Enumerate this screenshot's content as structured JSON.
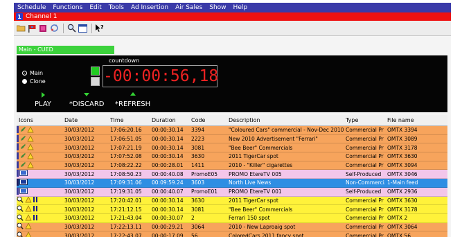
{
  "menu": [
    "Schedule",
    "Functions",
    "Edit",
    "Tools",
    "Ad Insertion",
    "Air Sales",
    "Show",
    "Help"
  ],
  "channel": {
    "number": "1",
    "title": "Channel 1"
  },
  "status": "Main - CUED",
  "countdown": {
    "label": "countdown",
    "value": "-00:00:56,18",
    "main_label": "Main",
    "clone_label": "Clone"
  },
  "controls": {
    "play": "PLAY",
    "discard": "*DISCARD",
    "refresh": "*REFRESH"
  },
  "columns": [
    "Icons",
    "Date",
    "Time",
    "Duration",
    "Code",
    "Description",
    "Type",
    "File name"
  ],
  "colors": {
    "orange": "#f7a45c",
    "pink": "#f3c6ea",
    "blue": "#2e8ee3",
    "yellow": "#fff23a",
    "accent_red": "#ee1111",
    "menubar": "#3a3aa8"
  },
  "rows": [
    {
      "color": "#f7a45c",
      "icons": "edit-warn",
      "date": "30/03/2012",
      "time": "17:06:20.16",
      "duration": "00:00:30.14",
      "code": "3394",
      "description": "\"Coloured Cars\" commercial - Nov-Dec 2010",
      "type": "Commercial Pr",
      "file": "OMTX   3394"
    },
    {
      "color": "#f7a45c",
      "icons": "edit-warn",
      "date": "30/03/2012",
      "time": "17:06:51.05",
      "duration": "00:00:30.14",
      "code": "2223",
      "description": "New 2010 Advertisement \"Ferrari\"",
      "type": "Commercial Pr",
      "file": "OMTX   3089"
    },
    {
      "color": "#f7a45c",
      "icons": "edit-warn",
      "date": "30/03/2012",
      "time": "17:07:21.19",
      "duration": "00:00:30.14",
      "code": "3081",
      "description": "\"Bee Beer\" Commercials",
      "type": "Commercial Pr",
      "file": "OMTX   3178"
    },
    {
      "color": "#f7a45c",
      "icons": "edit-warn",
      "date": "30/03/2012",
      "time": "17:07:52.08",
      "duration": "00:00:30.14",
      "code": "3630",
      "description": "2011 TigerCar spot",
      "type": "Commercial Pr",
      "file": "OMTX   3630"
    },
    {
      "color": "#f7a45c",
      "icons": "edit-warn",
      "date": "30/03/2012",
      "time": "17:08:22.22",
      "duration": "00:00:28.01",
      "code": "1411",
      "description": "2010 - \"Killer\" cigarettes",
      "type": "Commercial Pr",
      "file": "OMTX   3094"
    },
    {
      "color": "#f3c6ea",
      "icons": "screen",
      "date": "30/03/2012",
      "time": "17:08:50.23",
      "duration": "00:00:40.08",
      "code": "PromoE05",
      "description": "PROMO EtereTV 005",
      "type": "Self-Produced",
      "file": "OMTX   3046"
    },
    {
      "color": "#2e8ee3",
      "icons": "screen-blue",
      "date": "30/03/2012",
      "time": "17:09:31.06",
      "duration": "00:09:59.24",
      "code": "3603",
      "description": "North Live News",
      "type": "Non-Commerci.",
      "file": "1-Main feed"
    },
    {
      "color": "#f3c6ea",
      "icons": "screen",
      "date": "30/03/2012",
      "time": "17:19:31.05",
      "duration": "00:00:40.07",
      "code": "PromoE01",
      "description": "PROMO EtereTV 001",
      "type": "Self-Produced",
      "file": "OMTX   2936"
    },
    {
      "color": "#fff23a",
      "icons": "search-pause",
      "date": "30/03/2012",
      "time": "17:20:42.01",
      "duration": "00:00:30.14",
      "code": "3630",
      "description": "2011 TigerCar spot",
      "type": "Commercial Pr",
      "file": "OMTX   3630"
    },
    {
      "color": "#fff23a",
      "icons": "search-pause",
      "date": "30/03/2012",
      "time": "17:21:12.15",
      "duration": "00:00:30.14",
      "code": "3081",
      "description": "\"Bee Beer\" Commercials",
      "type": "Commercial Pr",
      "file": "OMTX   3178"
    },
    {
      "color": "#fff23a",
      "icons": "search-pause",
      "date": "30/03/2012",
      "time": "17:21:43.04",
      "duration": "00:00:30.07",
      "code": "2",
      "description": "Ferrari 150 spot",
      "type": "Commercial Pr",
      "file": "OMTX   2"
    },
    {
      "color": "#f7a45c",
      "icons": "search-warn",
      "date": "30/03/2012",
      "time": "17:22:13.11",
      "duration": "00:00:29.21",
      "code": "3064",
      "description": "2010 - New Laproaig spot",
      "type": "Commercial Pr",
      "file": "OMTX   3064"
    },
    {
      "color": "#f7a45c",
      "icons": "search-warn",
      "date": "30/03/2012",
      "time": "17:22:43.07",
      "duration": "00:00:17.09",
      "code": "56",
      "description": "ColoredCars 2011 fancy spot",
      "type": "Commercial Pr",
      "file": "OMTX   56"
    }
  ]
}
